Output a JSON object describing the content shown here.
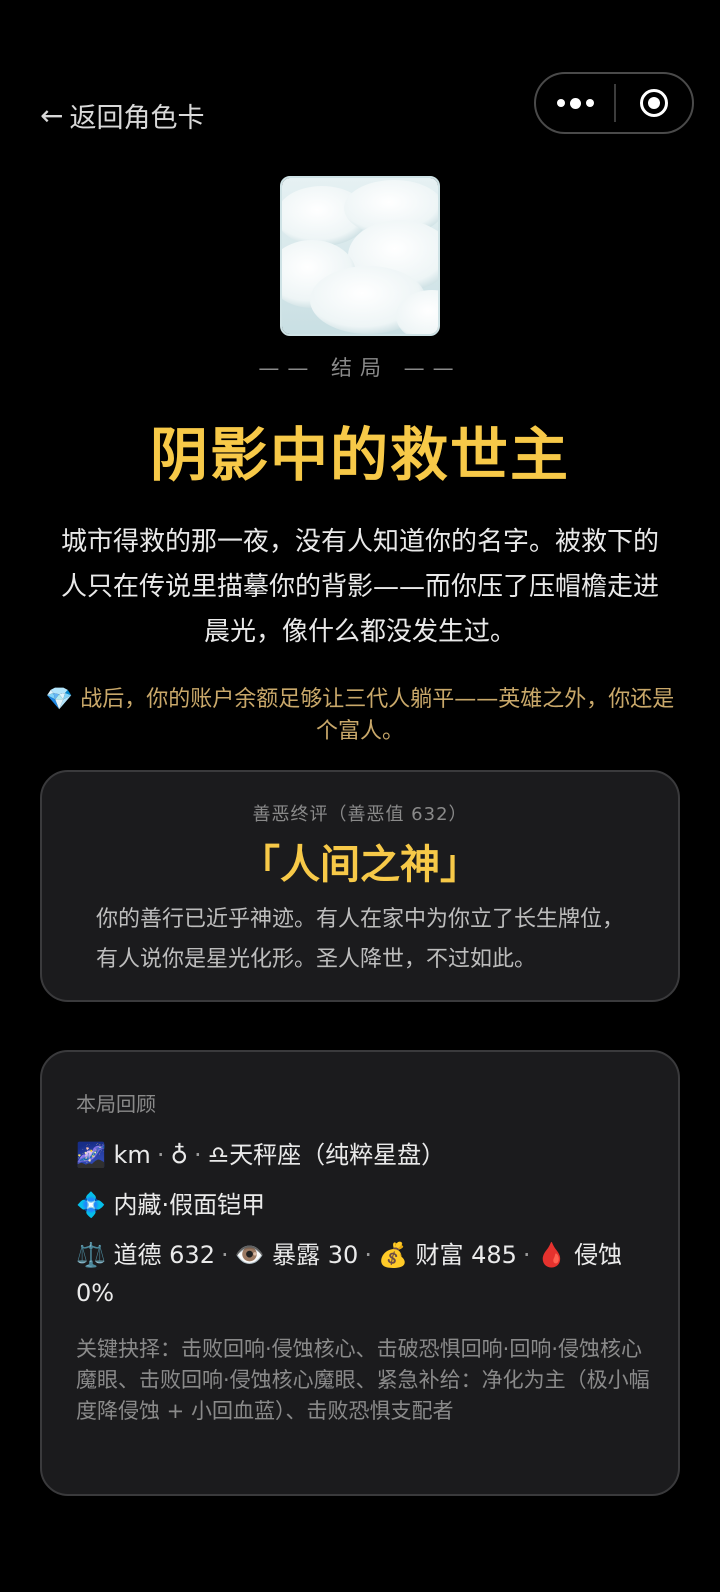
{
  "header": {
    "back_label": "返回角色卡"
  },
  "ending": {
    "label": "—— 结局 ——",
    "title": "阴影中的救世主",
    "description": "城市得救的那一夜，没有人知道你的名字。被救下的人只在传说里描摹你的背影——而你压了压帽檐走进晨光，像什么都没发生过。",
    "wealth_icon": "💎",
    "wealth_note": "战后，你的账户余额足够让三代人躺平——英雄之外，你还是个富人。"
  },
  "verdict": {
    "subtitle": "善恶终评（善恶值 632）",
    "name": "「人间之神」",
    "text": "你的善行已近乎神迹。有人在家中为你立了长生牌位，有人说你是星光化形。圣人降世，不过如此。"
  },
  "review": {
    "heading": "本局回顾",
    "identity": {
      "galaxy_icon": "🌌",
      "name": "km",
      "gender_symbol": "♁",
      "zodiac_icon": "♎",
      "zodiac": "天秤座（纯粹星盘）"
    },
    "trait": {
      "icon": "💠",
      "text": "内藏·假面铠甲"
    },
    "stats": {
      "morality_icon": "⚖️",
      "morality": "道德 632",
      "exposure_icon": "👁️",
      "exposure": "暴露 30",
      "wealth_icon": "💰",
      "wealth": "财富 485",
      "corrosion_icon": "🩸",
      "corrosion": "侵蚀 0%"
    },
    "key_choices": "关键抉择：击败回响·侵蚀核心、击破恐惧回响·回响·侵蚀核心魔眼、击败回响·侵蚀核心魔眼、紧急补给：净化为主（极小幅度降侵蚀 + 小回血蓝）、击败恐惧支配者"
  }
}
